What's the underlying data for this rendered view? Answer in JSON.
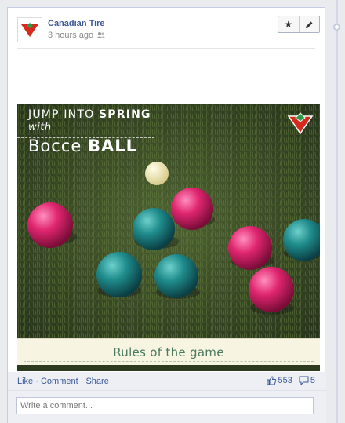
{
  "post": {
    "page_name": "Canadian Tire",
    "timestamp": "3 hours ago",
    "audience_icon": "friends-icon",
    "actions": {
      "star_icon": "star-icon",
      "edit_icon": "pencil-icon"
    }
  },
  "media": {
    "headline_line1_normal": "JUMP INTO ",
    "headline_line1_bold": "SPRING",
    "headline_line2": "with",
    "headline_line3_normal": "Bocce ",
    "headline_line3_bold": "BALL",
    "caption": "Rules of the game",
    "logo": "canadian-tire-logo"
  },
  "footer": {
    "like": "Like",
    "comment": "Comment",
    "share": "Share",
    "separator": "·",
    "likes_count": "553",
    "comments_count": "5"
  },
  "comment_input": {
    "placeholder": "Write a comment..."
  },
  "colors": {
    "link": "#3b5998",
    "brand_red": "#d52b1e",
    "caption_text": "#4b7a5f"
  }
}
